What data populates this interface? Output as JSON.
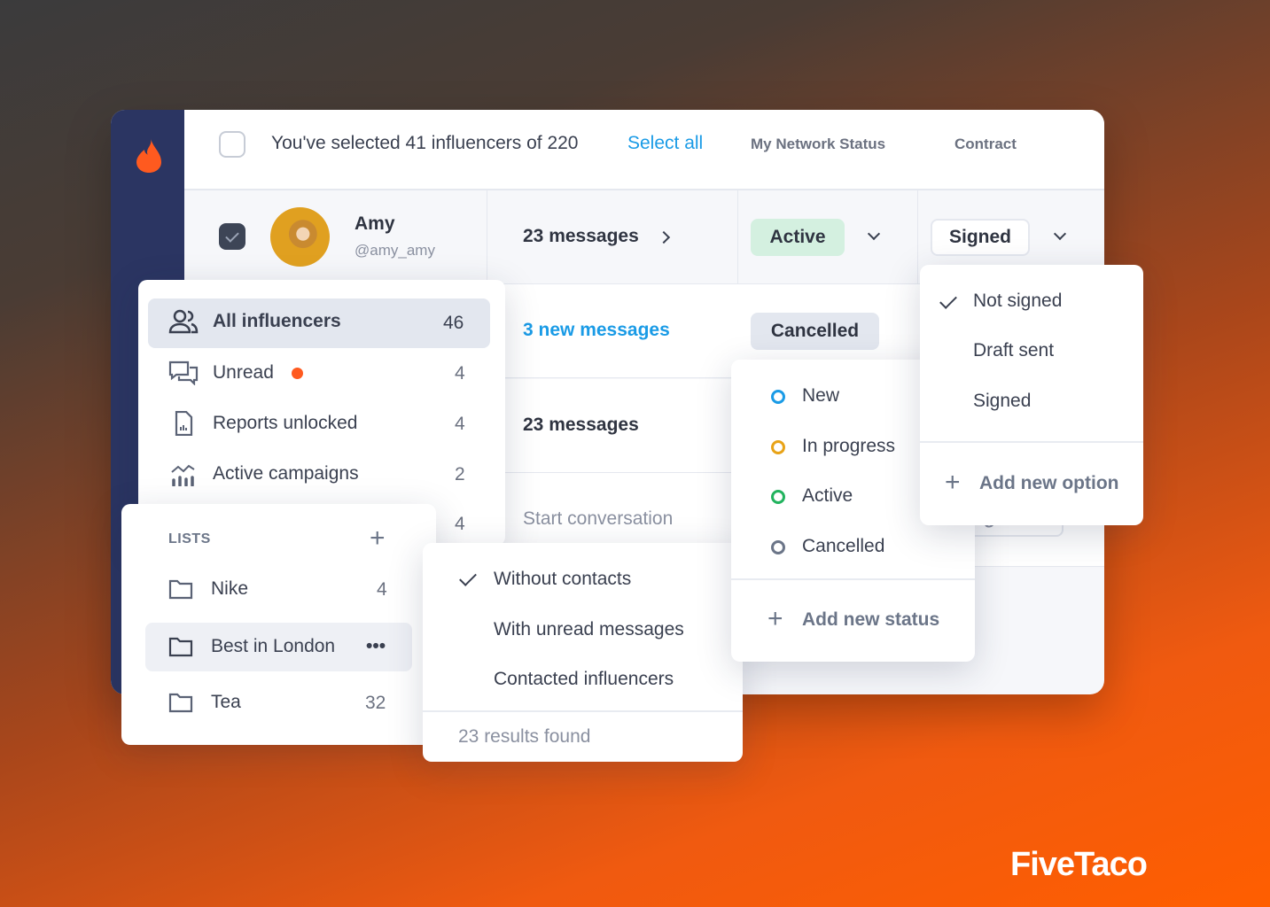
{
  "header": {
    "selection_text": "You've selected 41 influencers of 220",
    "select_all": "Select all",
    "columns": [
      "My Network Status",
      "Contract"
    ]
  },
  "rows": [
    {
      "name": "Amy",
      "handle": "@amy_amy",
      "messages": "23 messages",
      "status": "Active",
      "contract": "Signed"
    },
    {
      "messages": "3 new messages",
      "status": "Cancelled"
    },
    {
      "messages": "23 messages"
    },
    {
      "messages": "Start conversation",
      "contract": "Signed"
    }
  ],
  "filters": [
    {
      "label": "All influencers",
      "count": "46",
      "icon": "users-icon"
    },
    {
      "label": "Unread",
      "count": "4",
      "icon": "chat-icon"
    },
    {
      "label": "Reports unlocked",
      "count": "4",
      "icon": "report-icon"
    },
    {
      "label": "Active campaigns",
      "count": "2",
      "icon": "chart-icon"
    },
    {
      "count": "4"
    }
  ],
  "lists": {
    "title": "LISTS",
    "items": [
      {
        "label": "Nike",
        "count": "4"
      },
      {
        "label": "Best in London",
        "count": "•••"
      },
      {
        "label": "Tea",
        "count": "32"
      }
    ]
  },
  "contact_filter": {
    "options": [
      "Without contacts",
      "With unread messages",
      "Contacted influencers"
    ],
    "selected": "Without contacts",
    "results": "23 results found"
  },
  "status_menu": {
    "options": [
      {
        "label": "New",
        "color": "#1a9be6"
      },
      {
        "label": "In progress",
        "color": "#e8a317"
      },
      {
        "label": "Active",
        "color": "#22b35e"
      },
      {
        "label": "Cancelled",
        "color": "#6b7588"
      }
    ],
    "add": "Add new status"
  },
  "contract_menu": {
    "options": [
      "Not signed",
      "Draft sent",
      "Signed"
    ],
    "selected": "Not signed",
    "add": "Add new option"
  },
  "brand": "FiveTaco",
  "colors": {
    "accent": "#ff5a1f",
    "link": "#1a9be6",
    "sidebar": "#2b3562"
  }
}
